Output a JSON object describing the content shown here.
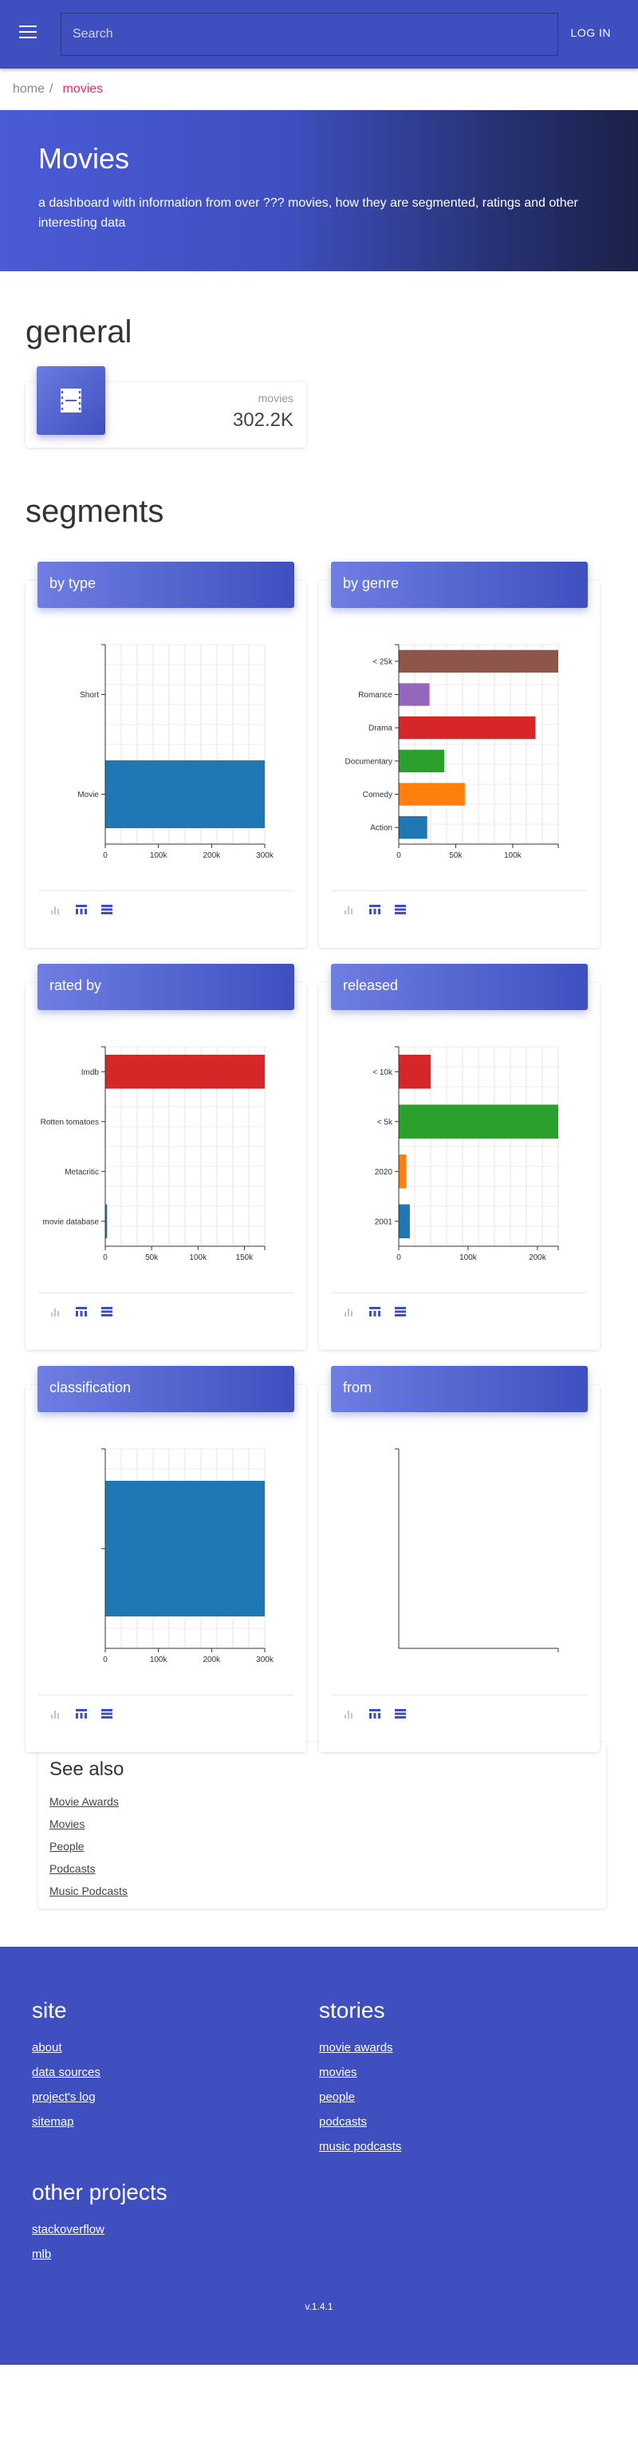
{
  "header": {
    "search_placeholder": "Search",
    "login_label": "LOG IN"
  },
  "breadcrumb": {
    "home": "home",
    "separator": "/",
    "current": "movies"
  },
  "hero": {
    "title": "Movies",
    "description": "a dashboard with information from over ??? movies, how they are segmented, ratings and other interesting data"
  },
  "general": {
    "title": "general",
    "stat": {
      "label": "movies",
      "value": "302.2K",
      "icon": "film-icon"
    }
  },
  "segments": {
    "title": "segments"
  },
  "colors": {
    "primary": "#3f4fbf",
    "accent": "#e6296b",
    "blue": "#1f77b4",
    "orange": "#ff7f0e",
    "green": "#2ca02c",
    "red": "#d62728",
    "purple": "#9467bd",
    "brown": "#8c564b"
  },
  "chart_data": [
    {
      "id": "by-type",
      "type": "bar",
      "orientation": "horizontal",
      "title": "by type",
      "categories": [
        "Short",
        "Movie"
      ],
      "values": [
        0,
        300000
      ],
      "colors": [
        "#1f77b4",
        "#1f77b4"
      ],
      "xlim": [
        0,
        300000
      ],
      "xticks": [
        0,
        100000,
        200000,
        300000
      ],
      "xtick_labels": [
        "0",
        "100k",
        "200k",
        "300k"
      ],
      "grid": true
    },
    {
      "id": "by-genre",
      "type": "bar",
      "orientation": "horizontal",
      "title": "by genre",
      "categories": [
        "< 25k",
        "Romance",
        "Drama",
        "Documentary",
        "Comedy",
        "Action"
      ],
      "values": [
        140000,
        27000,
        120000,
        40000,
        58000,
        25000
      ],
      "colors": [
        "#8c564b",
        "#9467bd",
        "#d62728",
        "#2ca02c",
        "#ff7f0e",
        "#1f77b4"
      ],
      "xlim": [
        0,
        140000
      ],
      "xticks": [
        0,
        50000,
        100000
      ],
      "xtick_labels": [
        "0",
        "50k",
        "100k"
      ],
      "grid": true
    },
    {
      "id": "rated-by",
      "type": "bar",
      "orientation": "horizontal",
      "title": "rated by",
      "categories": [
        "Imdb",
        "Rotten tomatoes",
        "Metacritic",
        "movie database"
      ],
      "values": [
        172000,
        500,
        0,
        2000
      ],
      "colors": [
        "#d62728",
        "#2ca02c",
        "#ff7f0e",
        "#1f77b4"
      ],
      "xlim": [
        0,
        172000
      ],
      "xticks": [
        0,
        50000,
        100000,
        150000
      ],
      "xtick_labels": [
        "0",
        "50k",
        "100k",
        "150k"
      ],
      "grid": true
    },
    {
      "id": "released",
      "type": "bar",
      "orientation": "horizontal",
      "title": "released",
      "categories": [
        "< 10k",
        "< 5k",
        "2020",
        "2001"
      ],
      "values": [
        46000,
        230000,
        11000,
        16000
      ],
      "colors": [
        "#d62728",
        "#2ca02c",
        "#ff7f0e",
        "#1f77b4"
      ],
      "xlim": [
        0,
        230000
      ],
      "xticks": [
        0,
        100000,
        200000
      ],
      "xtick_labels": [
        "0",
        "100k",
        "200k"
      ],
      "grid": true
    },
    {
      "id": "classification",
      "type": "bar",
      "orientation": "horizontal",
      "title": "classification",
      "categories": [
        ""
      ],
      "values": [
        300000
      ],
      "colors": [
        "#1f77b4"
      ],
      "xlim": [
        0,
        300000
      ],
      "xticks": [
        0,
        100000,
        200000,
        300000
      ],
      "xtick_labels": [
        "0",
        "100k",
        "200k",
        "300k"
      ],
      "grid": true
    },
    {
      "id": "from",
      "type": "bar",
      "orientation": "horizontal",
      "title": "from",
      "categories": [],
      "values": [],
      "colors": [],
      "xlim": [
        0,
        1
      ],
      "xticks": [],
      "xtick_labels": [],
      "grid": false
    }
  ],
  "see_also": {
    "title": "See also",
    "links": [
      "Movie Awards",
      "Movies",
      "People",
      "Podcasts",
      "Music Podcasts"
    ]
  },
  "footer": {
    "site": {
      "title": "site",
      "links": [
        "about",
        "data sources",
        "project's log",
        "sitemap"
      ]
    },
    "stories": {
      "title": "stories",
      "links": [
        "movie awards",
        "movies",
        "people",
        "podcasts",
        "music podcasts"
      ]
    },
    "other": {
      "title": "other projects",
      "links": [
        "stackoverflow",
        "mlb"
      ]
    },
    "version": "v.1.4.1"
  }
}
